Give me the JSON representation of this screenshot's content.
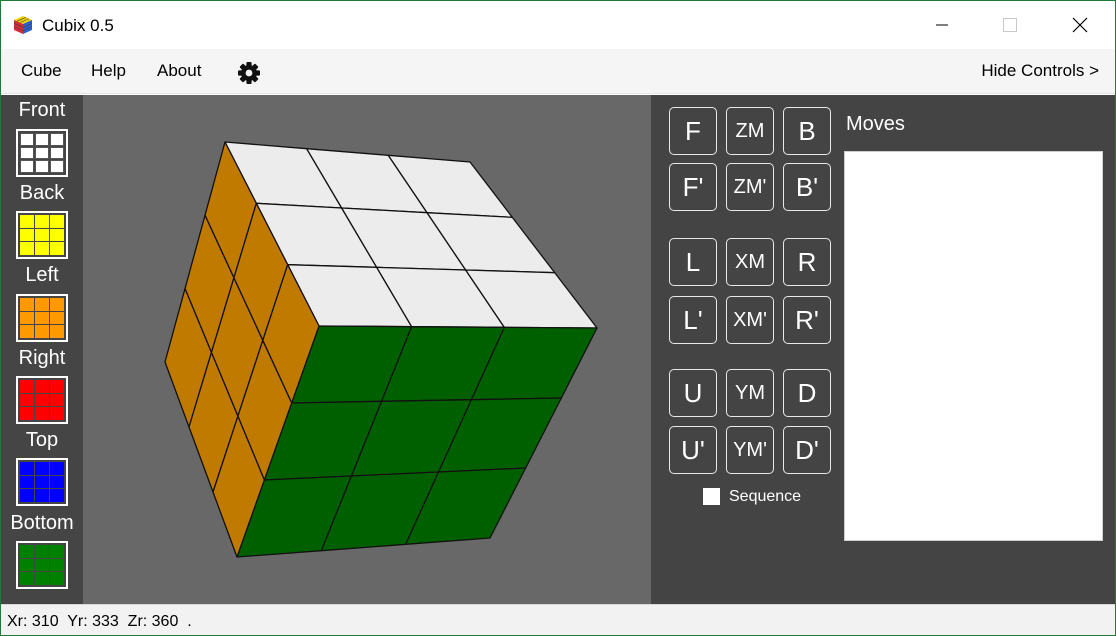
{
  "window": {
    "title": "Cubix 0.5",
    "controls": {
      "minimize": "minimize-icon",
      "maximize": "maximize-icon",
      "close": "close-icon"
    }
  },
  "menu": {
    "items": [
      "Cube",
      "Help",
      "About"
    ],
    "settings_icon": "gear-icon",
    "hide_controls": "Hide Controls >"
  },
  "faces": [
    {
      "label": "Front",
      "color": "#ffffff"
    },
    {
      "label": "Back",
      "color": "#ffff00"
    },
    {
      "label": "Left",
      "color": "#ff9900"
    },
    {
      "label": "Right",
      "color": "#ff0000"
    },
    {
      "label": "Top",
      "color": "#0000ff"
    },
    {
      "label": "Bottom",
      "color": "#008000"
    }
  ],
  "cube_view": {
    "top_face_color": "#ececec",
    "front_face_color": "#006000",
    "left_face_color": "#c07a00",
    "rotation": {
      "xr": 310,
      "yr": 333,
      "zr": 360
    }
  },
  "move_buttons": [
    [
      "F",
      "ZM",
      "B"
    ],
    [
      "F'",
      "ZM'",
      "B'"
    ],
    [
      "L",
      "XM",
      "R"
    ],
    [
      "L'",
      "XM'",
      "R'"
    ],
    [
      "U",
      "YM",
      "D"
    ],
    [
      "U'",
      "YM'",
      "D'"
    ]
  ],
  "sequence": {
    "label": "Sequence",
    "checked": false
  },
  "moves": {
    "label": "Moves",
    "list": []
  },
  "status": {
    "text": "Xr: 310  Yr: 333  Zr: 360  ."
  }
}
